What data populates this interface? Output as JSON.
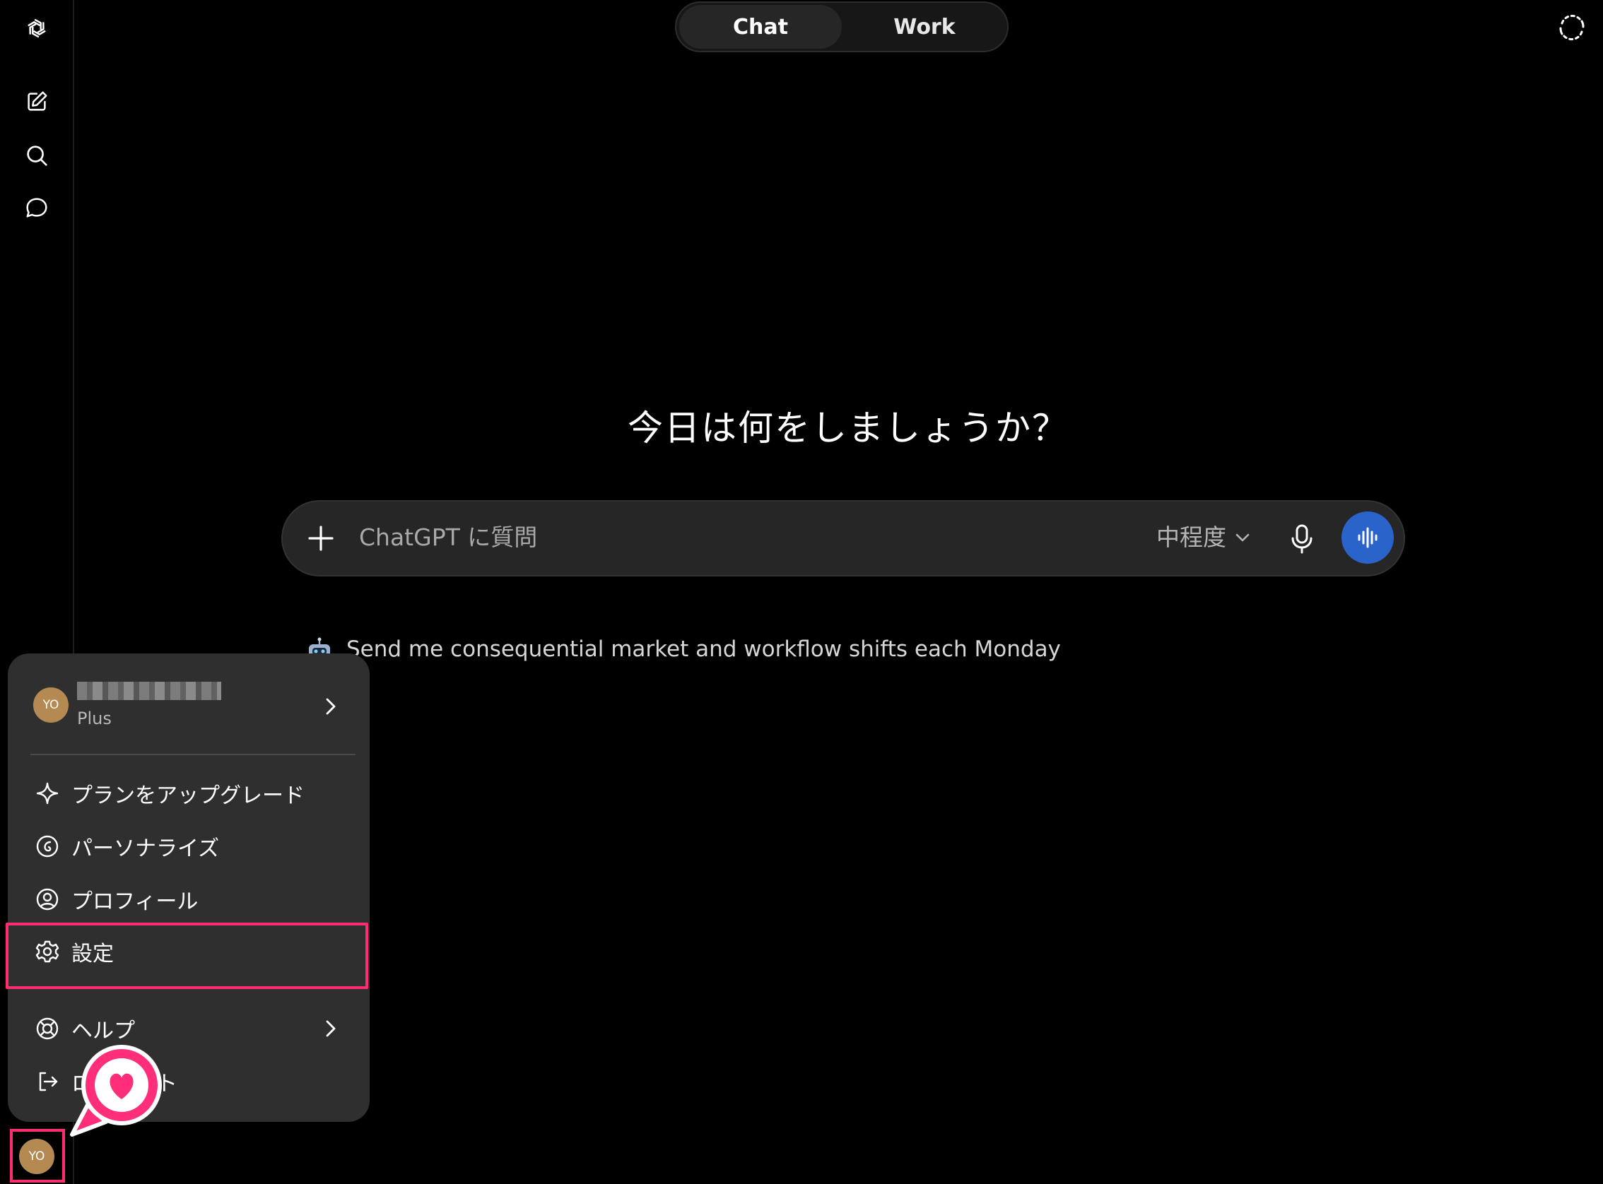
{
  "header": {
    "tabs": [
      {
        "label": "Chat",
        "active": true
      },
      {
        "label": "Work",
        "active": false
      }
    ]
  },
  "sidebar": {
    "icons": [
      "openai-logo-icon",
      "new-chat-icon",
      "search-icon",
      "chat-bubble-icon"
    ]
  },
  "main": {
    "headline": "今日は何をしましょうか？",
    "composer": {
      "placeholder": "ChatGPT に質問",
      "effort_label": "中程度"
    },
    "suggestion": "Send me consequential market and workflow shifts each Monday"
  },
  "account_menu": {
    "avatar_initials": "YO",
    "plan": "Plus",
    "items": [
      {
        "label": "プランをアップグレード",
        "icon": "sparkle-icon"
      },
      {
        "label": "パーソナライズ",
        "icon": "personalize-icon"
      },
      {
        "label": "プロフィール",
        "icon": "profile-icon"
      },
      {
        "label": "設定",
        "icon": "gear-icon"
      },
      {
        "label": "ヘルプ",
        "icon": "help-lifebuoy-icon"
      },
      {
        "label": "ログアウト",
        "icon": "logout-icon"
      }
    ]
  },
  "user": {
    "initials": "YO"
  },
  "colors": {
    "accent_blue": "#2a63c9",
    "highlight_pink": "#ff2d6f",
    "avatar": "#b48a52"
  }
}
